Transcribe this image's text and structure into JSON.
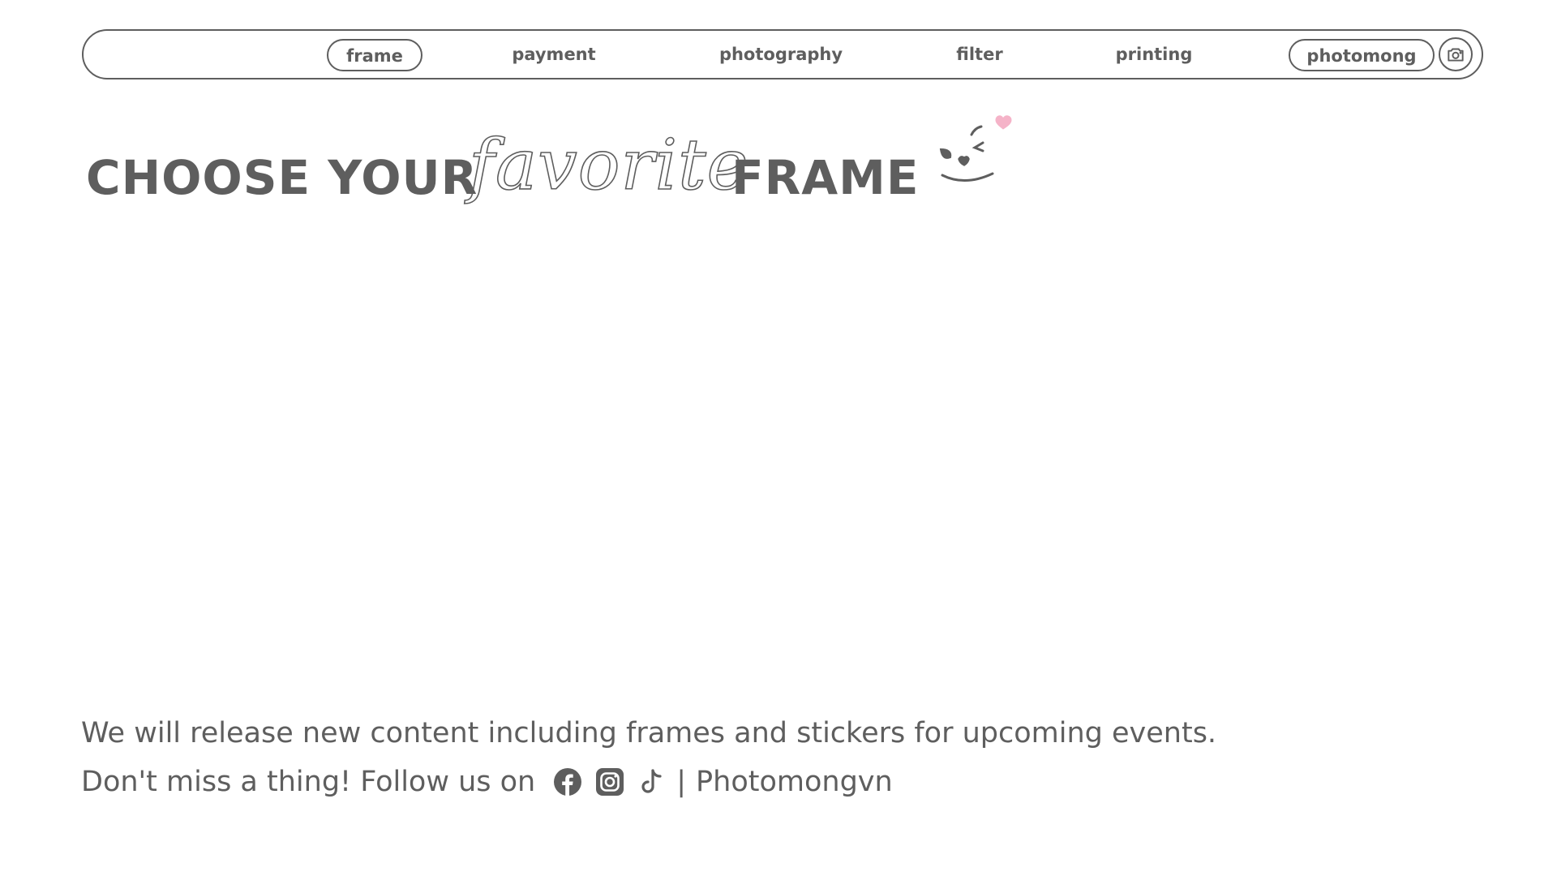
{
  "nav": {
    "items": [
      {
        "label": "frame",
        "active": true
      },
      {
        "label": "payment"
      },
      {
        "label": "photography"
      },
      {
        "label": "filter"
      },
      {
        "label": "printing"
      },
      {
        "label": "photomong",
        "outlined": true
      }
    ],
    "camera_icon": "camera-icon"
  },
  "headline": {
    "word1": "CHOOSE YOUR",
    "script": "favorite",
    "word2": "FRAME",
    "emoji_icon": "wink-heart-face-icon",
    "accent_color": "#f5b3c8"
  },
  "footer": {
    "line1": "We will release new content including frames and stickers for upcoming events.",
    "line2_prefix": "Don't miss a thing! Follow us on",
    "separator": "|",
    "handle": "Photomongvn",
    "socials": [
      "facebook-icon",
      "instagram-icon",
      "tiktok-icon"
    ]
  },
  "colors": {
    "text": "#5e5e5e",
    "background": "#ffffff"
  }
}
